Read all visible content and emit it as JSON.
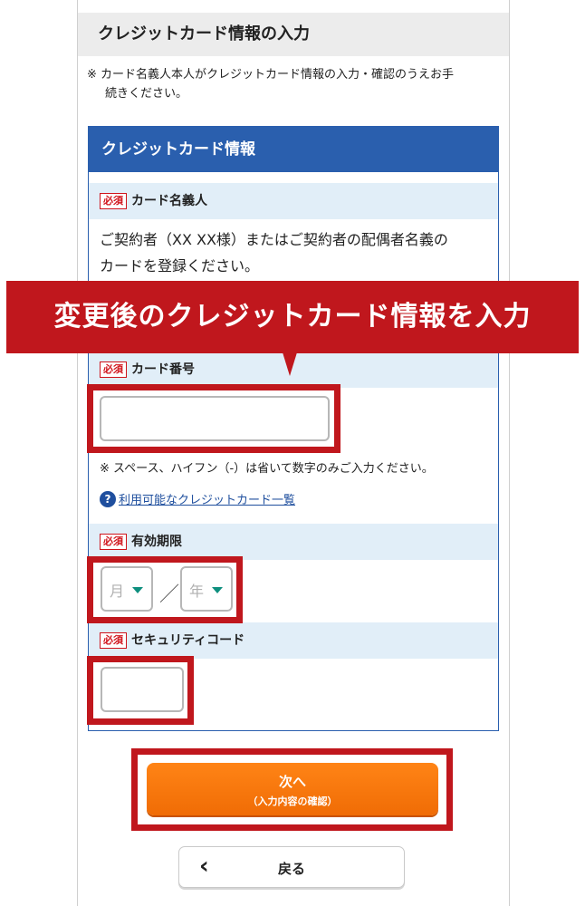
{
  "section_title": "クレジットカード情報の入力",
  "notice": {
    "line1": "※ カード名義人本人がクレジットカード情報の入力・確認のうえお手",
    "line2": "続きください。"
  },
  "card": {
    "title": "クレジットカード情報",
    "required_label": "必須",
    "holder": {
      "label": "カード名義人",
      "desc_line1": "ご契約者（XX XX様）またはご契約者の配偶者名義の",
      "desc_line2": "カードを登録ください。"
    },
    "number": {
      "label": "カード番号",
      "value": "",
      "hint": "※ スペース、ハイフン（-）は省いて数字のみご入力ください。"
    },
    "help_icon": "question-circle-icon",
    "help_link": "利用可能なクレジットカード一覧",
    "expiry": {
      "label": "有効期限",
      "month_placeholder": "月",
      "separator": "／",
      "year_placeholder": "年"
    },
    "security": {
      "label": "セキュリティコード",
      "value": ""
    }
  },
  "banner": "変更後のクレジットカード情報を入力",
  "next_button": {
    "line1": "次へ",
    "line2": "（入力内容の確認）"
  },
  "back_button": {
    "chevron": "く",
    "label": "戻る"
  },
  "colors": {
    "header_blue": "#2a5fae",
    "label_bg": "#e1eef8",
    "required_red": "#d0131b",
    "highlight_red": "#c0171d",
    "next_orange": "#f57a0d",
    "select_caret": "#0e8f7e"
  }
}
